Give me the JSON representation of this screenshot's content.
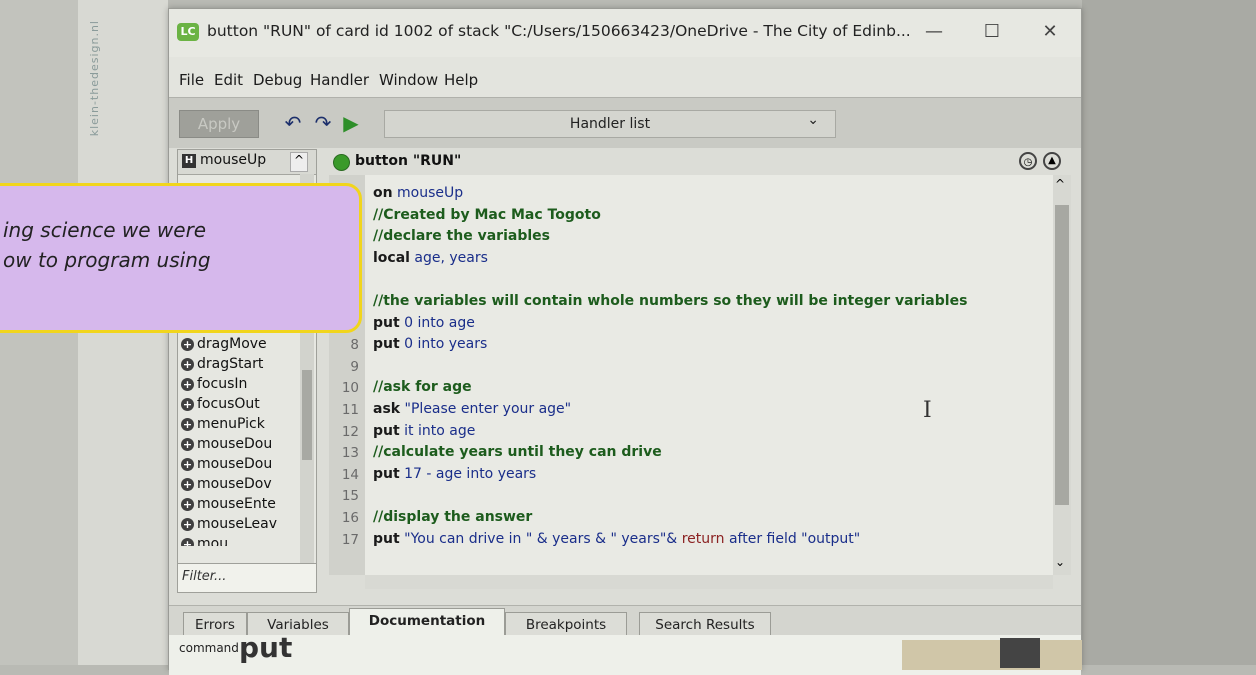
{
  "window": {
    "title": "button \"RUN\" of card id 1002 of stack \"C:/Users/150663423/OneDrive - The City of Edinb...",
    "app_icon": "LC",
    "minimize_symbol": "—",
    "maximize_symbol": "☐",
    "close_symbol": "✕"
  },
  "menubar": [
    "File",
    "Edit",
    "Debug",
    "Handler",
    "Window",
    "Help"
  ],
  "toolbar": {
    "apply_label": "Apply",
    "undo_icon": "↶",
    "redo_icon": "↷",
    "run_icon": "▶",
    "handler_select": "Handler list",
    "handler_select_caret": "⌄"
  },
  "handler_panel": {
    "header_badge": "H",
    "header_label": "mouseUp",
    "header_caret": "^",
    "items": [
      "dragMove",
      "dragStart",
      "focusIn",
      "focusOut",
      "menuPick",
      "mouseDou",
      "mouseDou",
      "mouseDov",
      "mouseEnte",
      "mouseLeav",
      "mou"
    ],
    "filter_placeholder": "Filter..."
  },
  "editor": {
    "title": "button \"RUN\"",
    "lines": [
      {
        "n": "1",
        "parts": [
          [
            "kw",
            "on"
          ],
          [
            "plain",
            " mouseUp"
          ]
        ]
      },
      {
        "n": "2",
        "parts": [
          [
            "cm",
            "  //Created by Mac Mac Togoto"
          ]
        ]
      },
      {
        "n": "3",
        "parts": [
          [
            "cm",
            "  //declare the variables"
          ]
        ]
      },
      {
        "n": "4",
        "parts": [
          [
            "kw",
            "  local"
          ],
          [
            "plain",
            " age, years"
          ]
        ]
      },
      {
        "n": "5",
        "parts": []
      },
      {
        "n": "6",
        "parts": [
          [
            "cm",
            "  //the variables will contain whole numbers so they will be integer variables"
          ]
        ]
      },
      {
        "n": "7",
        "parts": [
          [
            "kw",
            "  put"
          ],
          [
            "plain",
            " 0 into age"
          ]
        ]
      },
      {
        "n": "8",
        "parts": [
          [
            "kw",
            "  put"
          ],
          [
            "plain",
            " 0 into years"
          ]
        ]
      },
      {
        "n": "9",
        "parts": []
      },
      {
        "n": "10",
        "parts": [
          [
            "cm",
            "  //ask for age"
          ]
        ]
      },
      {
        "n": "11",
        "parts": [
          [
            "kw",
            "  ask"
          ],
          [
            "plain",
            " \"Please enter your age\""
          ]
        ]
      },
      {
        "n": "12",
        "parts": [
          [
            "kw",
            "  put"
          ],
          [
            "plain",
            " it into age"
          ]
        ]
      },
      {
        "n": "13",
        "parts": [
          [
            "cm",
            "  //calculate years until they can drive"
          ]
        ]
      },
      {
        "n": "14",
        "parts": [
          [
            "kw",
            "  put"
          ],
          [
            "plain",
            " 17 - age into years"
          ]
        ]
      },
      {
        "n": "15",
        "parts": []
      },
      {
        "n": "16",
        "parts": [
          [
            "cm",
            "  //display the answer"
          ]
        ]
      },
      {
        "n": "17",
        "parts": [
          [
            "kw",
            "  put"
          ],
          [
            "plain",
            " \"You can drive in \" & years & \" years\"& "
          ],
          [
            "red",
            "return"
          ],
          [
            "plain",
            " after field \"output\""
          ]
        ]
      }
    ],
    "cursor_glyph": "I"
  },
  "bottom_tabs": [
    "Errors",
    "Variables",
    "Documentation",
    "Breakpoints",
    "Search Results"
  ],
  "active_tab": "Documentation",
  "documentation": {
    "kind": "command",
    "word": "put"
  },
  "callout": {
    "line1": "ing science we were",
    "line2": "ow to program using"
  },
  "background_text": "klein-thedesign.nl",
  "colors": {
    "callout_fill": "#d6b8ec",
    "callout_border": "#f1d51c",
    "comment": "#1d5c1d",
    "string": "#1a2e8a"
  }
}
